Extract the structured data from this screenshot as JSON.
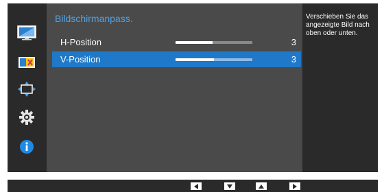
{
  "menu": {
    "title": "Bildschirmanpass.",
    "items": [
      {
        "label": "H-Position",
        "value": "3",
        "level": 0.48,
        "selected": false
      },
      {
        "label": "V-Position",
        "value": "3",
        "level": 0.5,
        "selected": true
      }
    ]
  },
  "help": {
    "text": "Verschieben Sie das angezeigte Bild nach oben oder unten."
  },
  "sidebar": {
    "icons": [
      "picture-icon",
      "color-icon",
      "size-position-icon",
      "settings-gear-icon",
      "info-icon"
    ]
  },
  "navbar": {
    "buttons": [
      "left-arrow-icon",
      "down-arrow-icon",
      "up-arrow-icon",
      "right-arrow-icon"
    ]
  },
  "colors": {
    "accent": "#1f78c8",
    "title": "#4aa3ea",
    "panel": "#4a4a4a",
    "frame": "#2a2a2a"
  }
}
